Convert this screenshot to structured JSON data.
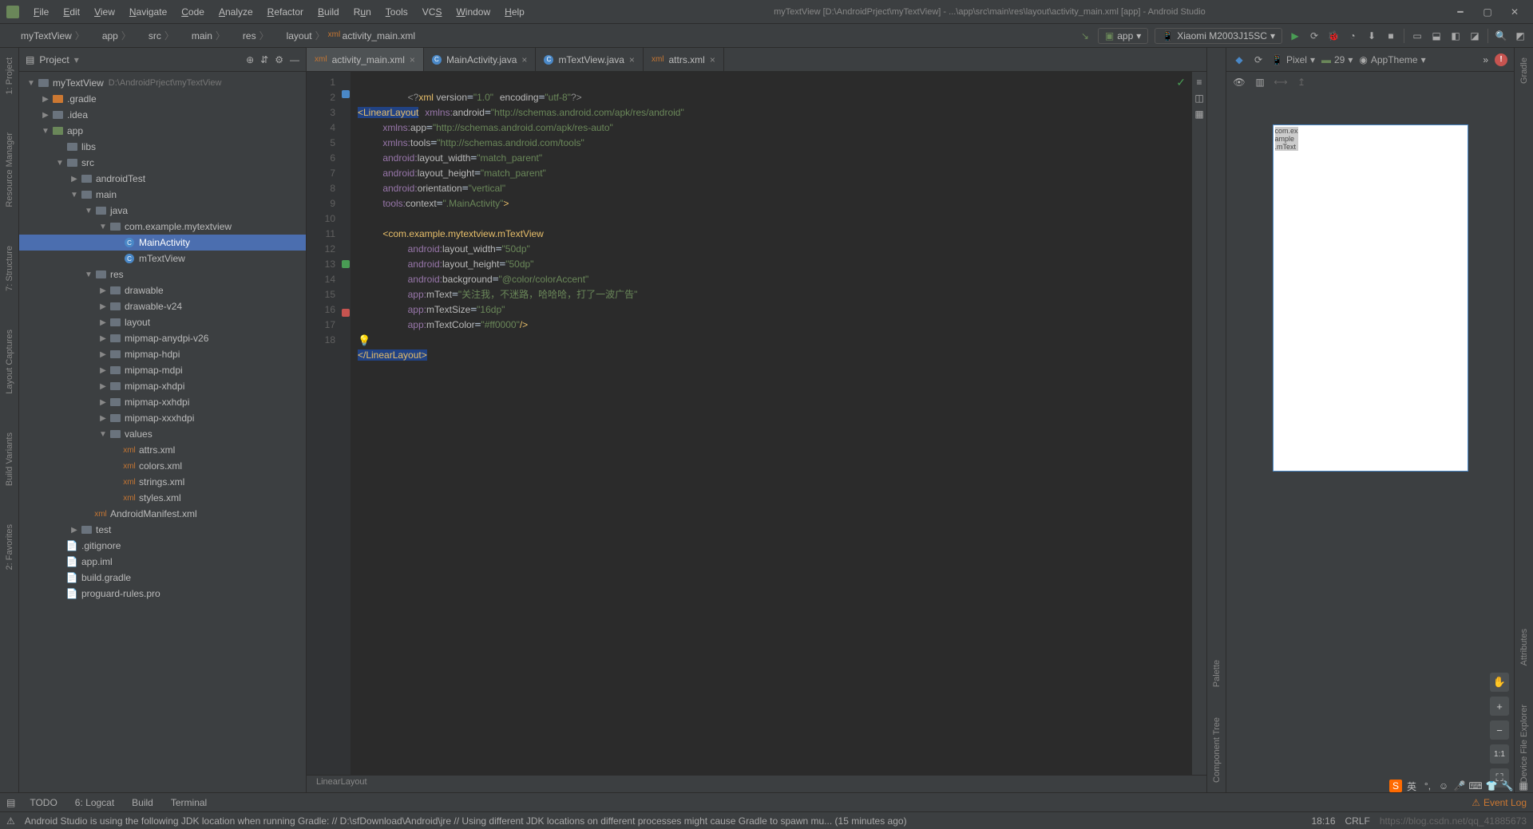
{
  "title": "myTextView [D:\\AndroidPrject\\myTextView] - ...\\app\\src\\main\\res\\layout\\activity_main.xml [app] - Android Studio",
  "menu": [
    "File",
    "Edit",
    "View",
    "Navigate",
    "Code",
    "Analyze",
    "Refactor",
    "Build",
    "Run",
    "Tools",
    "VCS",
    "Window",
    "Help"
  ],
  "menu_underline": [
    0,
    0,
    0,
    0,
    0,
    0,
    0,
    0,
    1,
    0,
    2,
    0,
    0
  ],
  "breadcrumb": [
    "myTextView",
    "app",
    "src",
    "main",
    "res",
    "layout",
    "activity_main.xml"
  ],
  "run_config": "app",
  "device": "Xiaomi M2003J15SC",
  "panel_title": "Project",
  "tree": [
    {
      "d": 0,
      "arrow": "▼",
      "icon": "folder",
      "label": "myTextView",
      "path": "D:\\AndroidPrject\\myTextView"
    },
    {
      "d": 1,
      "arrow": "▶",
      "icon": "folder orange",
      "label": ".gradle"
    },
    {
      "d": 1,
      "arrow": "▶",
      "icon": "folder",
      "label": ".idea"
    },
    {
      "d": 1,
      "arrow": "▼",
      "icon": "folder app",
      "label": "app"
    },
    {
      "d": 2,
      "arrow": "",
      "icon": "folder",
      "label": "libs"
    },
    {
      "d": 2,
      "arrow": "▼",
      "icon": "folder",
      "label": "src"
    },
    {
      "d": 3,
      "arrow": "▶",
      "icon": "folder",
      "label": "androidTest"
    },
    {
      "d": 3,
      "arrow": "▼",
      "icon": "folder",
      "label": "main"
    },
    {
      "d": 4,
      "arrow": "▼",
      "icon": "folder",
      "label": "java"
    },
    {
      "d": 5,
      "arrow": "▼",
      "icon": "folder",
      "label": "com.example.mytextview"
    },
    {
      "d": 6,
      "arrow": "",
      "icon": "class",
      "label": "MainActivity",
      "selected": true
    },
    {
      "d": 6,
      "arrow": "",
      "icon": "class",
      "label": "mTextView"
    },
    {
      "d": 4,
      "arrow": "▼",
      "icon": "folder",
      "label": "res"
    },
    {
      "d": 5,
      "arrow": "▶",
      "icon": "folder",
      "label": "drawable"
    },
    {
      "d": 5,
      "arrow": "▶",
      "icon": "folder",
      "label": "drawable-v24"
    },
    {
      "d": 5,
      "arrow": "▶",
      "icon": "folder",
      "label": "layout"
    },
    {
      "d": 5,
      "arrow": "▶",
      "icon": "folder",
      "label": "mipmap-anydpi-v26"
    },
    {
      "d": 5,
      "arrow": "▶",
      "icon": "folder",
      "label": "mipmap-hdpi"
    },
    {
      "d": 5,
      "arrow": "▶",
      "icon": "folder",
      "label": "mipmap-mdpi"
    },
    {
      "d": 5,
      "arrow": "▶",
      "icon": "folder",
      "label": "mipmap-xhdpi"
    },
    {
      "d": 5,
      "arrow": "▶",
      "icon": "folder",
      "label": "mipmap-xxhdpi"
    },
    {
      "d": 5,
      "arrow": "▶",
      "icon": "folder",
      "label": "mipmap-xxxhdpi"
    },
    {
      "d": 5,
      "arrow": "▼",
      "icon": "folder",
      "label": "values"
    },
    {
      "d": 6,
      "arrow": "",
      "icon": "xml",
      "label": "attrs.xml"
    },
    {
      "d": 6,
      "arrow": "",
      "icon": "xml",
      "label": "colors.xml"
    },
    {
      "d": 6,
      "arrow": "",
      "icon": "xml",
      "label": "strings.xml"
    },
    {
      "d": 6,
      "arrow": "",
      "icon": "xml",
      "label": "styles.xml"
    },
    {
      "d": 4,
      "arrow": "",
      "icon": "xml",
      "label": "AndroidManifest.xml"
    },
    {
      "d": 3,
      "arrow": "▶",
      "icon": "folder",
      "label": "test"
    },
    {
      "d": 2,
      "arrow": "",
      "icon": "file",
      "label": ".gitignore"
    },
    {
      "d": 2,
      "arrow": "",
      "icon": "file",
      "label": "app.iml"
    },
    {
      "d": 2,
      "arrow": "",
      "icon": "file",
      "label": "build.gradle"
    },
    {
      "d": 2,
      "arrow": "",
      "icon": "file",
      "label": "proguard-rules.pro"
    }
  ],
  "tabs": [
    {
      "icon": "xml",
      "label": "activity_main.xml",
      "active": true
    },
    {
      "icon": "class",
      "label": "MainActivity.java"
    },
    {
      "icon": "class",
      "label": "mTextView.java"
    },
    {
      "icon": "xml",
      "label": "attrs.xml"
    }
  ],
  "code_lines": 18,
  "markers": {
    "2": "#4a88c7",
    "13": "#499c54",
    "16": "#c75450"
  },
  "breadcrumb_bottom": "LinearLayout",
  "preview": {
    "device": "Pixel",
    "api": "29",
    "theme": "AppTheme",
    "label": "com.ex\nample\n.mText"
  },
  "left_gutter": [
    "1: Project",
    "Resource Manager",
    "7: Structure",
    "Layout Captures",
    "Build Variants",
    "2: Favorites"
  ],
  "right_gutter_top": [
    "Gradle"
  ],
  "right_gutter_bottom": [
    "Attributes",
    "Device File Explorer"
  ],
  "side_gutter": [
    "Palette",
    "Component Tree"
  ],
  "bottom_tools": [
    "TODO",
    "6: Logcat",
    "Build",
    "Terminal"
  ],
  "event_log": "Event Log",
  "status_msg": "Android Studio is using the following JDK location when running Gradle: // D:\\sfDownload\\Android\\jre // Using different JDK locations on different processes might cause Gradle to spawn mu... (15 minutes ago)",
  "status_right": [
    "18:16",
    "CRLF",
    "https://blog.csdn.net/qq_41885673"
  ]
}
